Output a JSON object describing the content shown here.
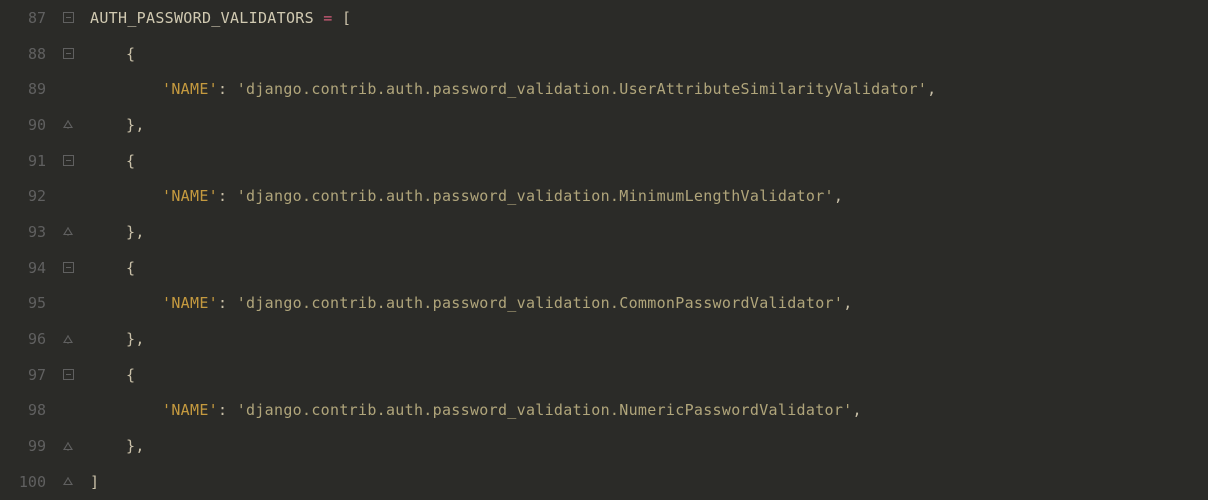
{
  "lines": {
    "n87": "87",
    "n88": "88",
    "n89": "89",
    "n90": "90",
    "n91": "91",
    "n92": "92",
    "n93": "93",
    "n94": "94",
    "n95": "95",
    "n96": "96",
    "n97": "97",
    "n98": "98",
    "n99": "99",
    "n100": "100"
  },
  "tokens": {
    "var_name": "AUTH_PASSWORD_VALIDATORS",
    "equals": " = ",
    "open_bracket": "[",
    "open_brace": "{",
    "close_brace_comma": "},",
    "close_bracket": "]",
    "key_name": "'NAME'",
    "colon": ":",
    "space": " ",
    "val1": "'django.contrib.auth.password_validation.UserAttributeSimilarityValidator'",
    "val2": "'django.contrib.auth.password_validation.MinimumLengthValidator'",
    "val3": "'django.contrib.auth.password_validation.CommonPasswordValidator'",
    "val4": "'django.contrib.auth.password_validation.NumericPasswordValidator'",
    "comma": ","
  }
}
